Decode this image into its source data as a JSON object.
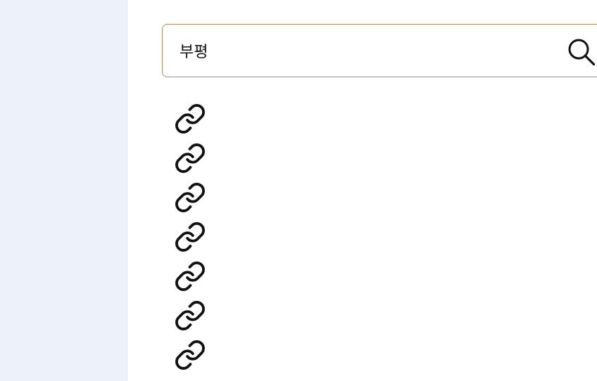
{
  "search": {
    "value": "부평",
    "placeholder": ""
  },
  "icons": {
    "search": "search-icon",
    "result_link": "link-icon"
  },
  "results": [
    {
      "icon": "link-icon"
    },
    {
      "icon": "link-icon"
    },
    {
      "icon": "link-icon"
    },
    {
      "icon": "link-icon"
    },
    {
      "icon": "link-icon"
    },
    {
      "icon": "link-icon"
    },
    {
      "icon": "link-icon"
    }
  ],
  "colors": {
    "sidebar_bg": "#edf1f9",
    "search_border": "#b98a55",
    "icon": "#111111"
  }
}
